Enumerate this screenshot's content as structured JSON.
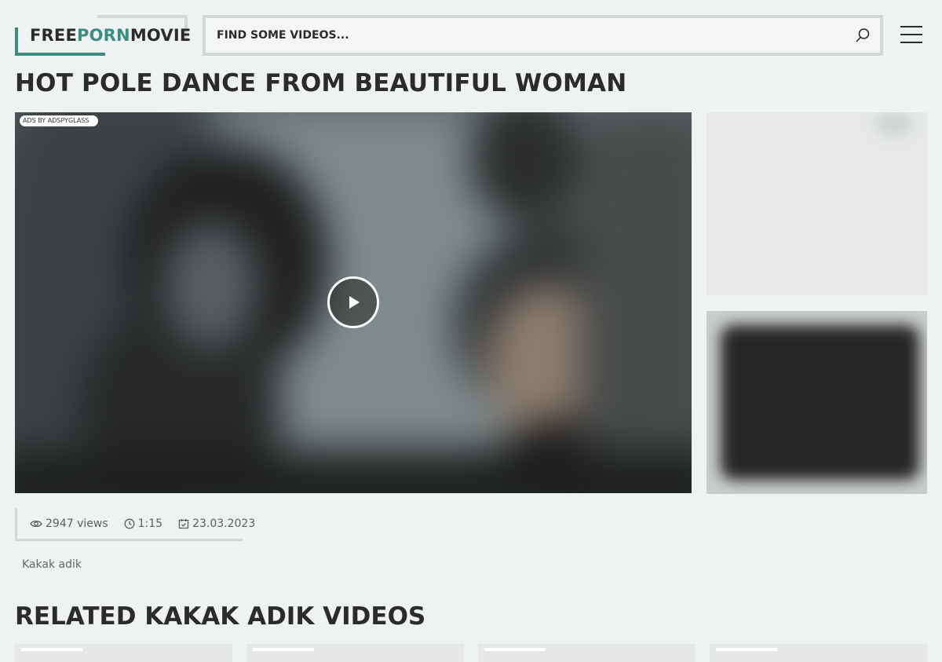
{
  "header": {
    "logo": {
      "part1": "FREE",
      "part2": "PORN",
      "part3": "MOVIE",
      "accent_color": "#3d8c80"
    },
    "search": {
      "placeholder": "FIND SOME VIDEOS...",
      "value": ""
    }
  },
  "video": {
    "title": "HOT POLE DANCE FROM BEAUTIFUL WOMAN",
    "ad_badge": "ADS BY ADSPYGLASS",
    "views": "2947 views",
    "duration": "1:15",
    "date": "23.03.2023",
    "tag": "Kakak adik"
  },
  "related": {
    "title": "RELATED KAKAK ADIK VIDEOS"
  }
}
